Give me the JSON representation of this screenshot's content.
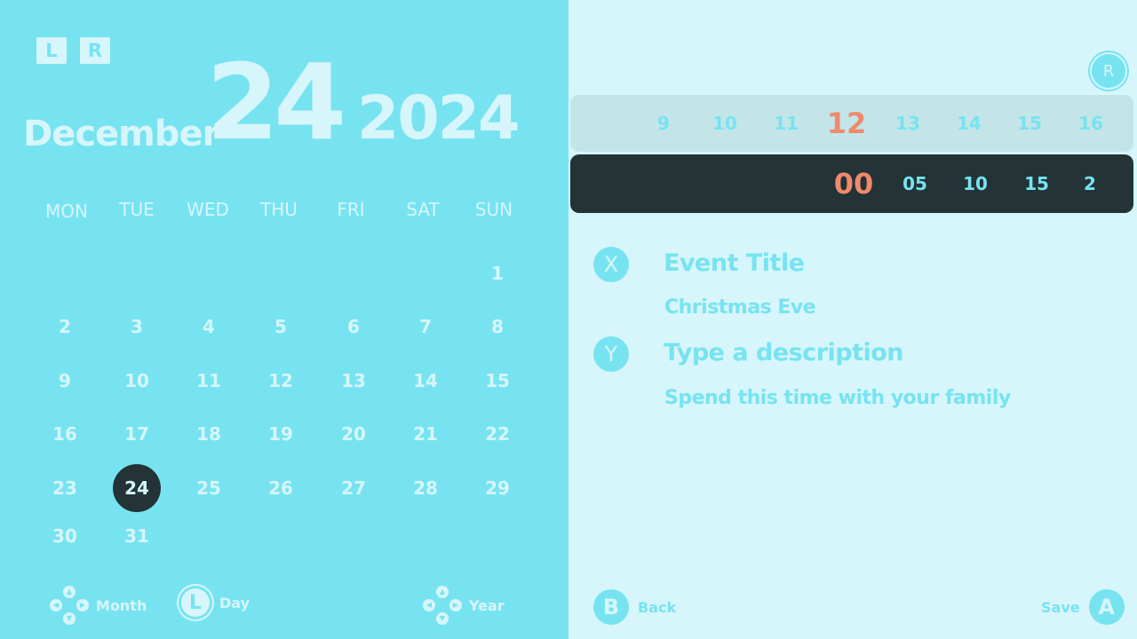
{
  "shoulders": {
    "left": "L",
    "right": "R"
  },
  "header": {
    "month": "December",
    "day": "24",
    "year": "2024"
  },
  "weekdays": [
    "MON",
    "TUE",
    "WED",
    "THU",
    "FRI",
    "SAT",
    "SUN"
  ],
  "days": [
    "1",
    "2",
    "3",
    "4",
    "5",
    "6",
    "7",
    "8",
    "9",
    "10",
    "11",
    "12",
    "13",
    "14",
    "15",
    "16",
    "17",
    "18",
    "19",
    "20",
    "21",
    "22",
    "23",
    "24",
    "25",
    "26",
    "27",
    "28",
    "29",
    "30",
    "31"
  ],
  "selected_day": "24",
  "legend": {
    "month": "Month",
    "day": "Day",
    "year": "Year",
    "stick_glyph": "L"
  },
  "hours": [
    "9",
    "10",
    "11",
    "12",
    "13",
    "14",
    "15",
    "16"
  ],
  "current_hour": "12",
  "minutes": [
    "00",
    "05",
    "10",
    "15",
    "2"
  ],
  "current_minute": "00",
  "r_button": "R",
  "fields": {
    "title": {
      "button": "X",
      "label": "Event Title",
      "value": "Christmas Eve"
    },
    "description": {
      "button": "Y",
      "label": "Type a description",
      "value": "Spend this time with your family"
    }
  },
  "footer": {
    "back_button": "B",
    "back_label": "Back",
    "save_button": "A",
    "save_label": "Save"
  },
  "colors": {
    "panel": "#77e3f1",
    "light": "#d6f6fb",
    "dark": "#233336",
    "accent": "#f08a6c"
  },
  "icons": {
    "month": "dpad-icon",
    "day": "left-stick-icon",
    "year": "dpad-icon"
  }
}
